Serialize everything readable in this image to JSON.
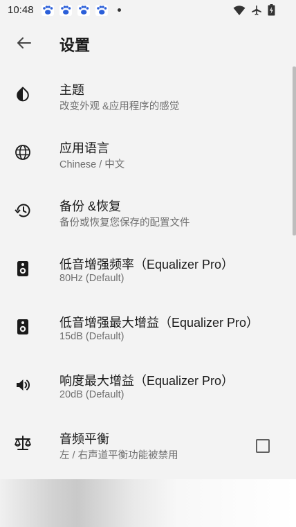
{
  "status_bar": {
    "time": "10:48",
    "notification_icons": [
      "paw-icon",
      "paw-icon",
      "paw-icon",
      "paw-icon"
    ],
    "system_icons": [
      "wifi-icon",
      "airplane-icon",
      "battery-icon"
    ]
  },
  "header": {
    "back_icon": "arrow-left-icon",
    "title": "设置"
  },
  "settings": [
    {
      "icon": "contrast-drop-icon",
      "title": "主题",
      "subtitle": "改变外观 &应用程序的感觉"
    },
    {
      "icon": "globe-icon",
      "title": "应用语言",
      "subtitle": "Chinese / 中文"
    },
    {
      "icon": "restore-history-icon",
      "title": "备份 &恢复",
      "subtitle": "备份或恢复您保存的配置文件"
    },
    {
      "icon": "speaker-icon",
      "title": "低音增强频率（Equalizer Pro）",
      "subtitle": "80Hz (Default)"
    },
    {
      "icon": "speaker-icon",
      "title": "低音增强最大增益（Equalizer Pro）",
      "subtitle": "15dB (Default)"
    },
    {
      "icon": "volume-icon",
      "title": "响度最大增益（Equalizer Pro）",
      "subtitle": "20dB (Default)"
    },
    {
      "icon": "balance-scale-icon",
      "title": "音频平衡",
      "subtitle": "左 / 右声道平衡功能被禁用",
      "checked": false
    }
  ],
  "colors": {
    "background": "#f3f3f3",
    "text_primary": "#1b1b1b",
    "text_secondary": "#6f6f6f"
  }
}
